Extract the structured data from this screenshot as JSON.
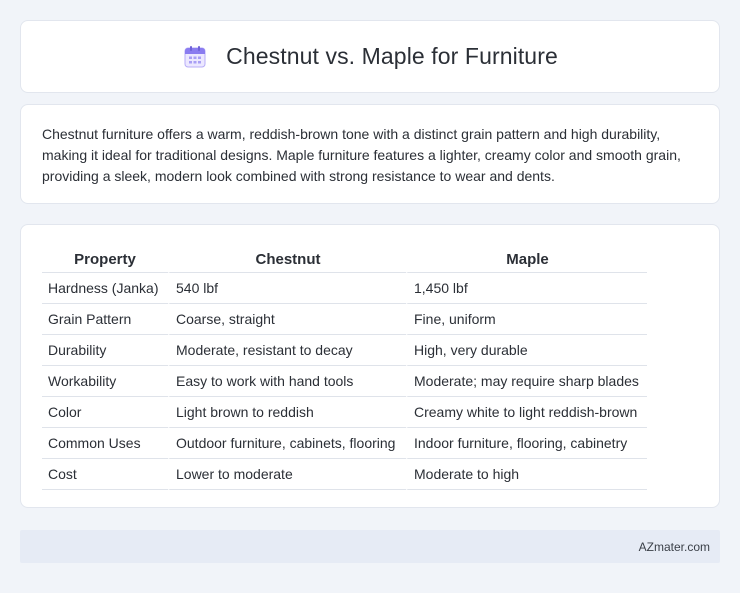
{
  "header": {
    "title": "Chestnut vs. Maple for Furniture",
    "icon": "calendar-icon",
    "icon_color": "#8a7cf0"
  },
  "description": "Chestnut furniture offers a warm, reddish-brown tone with a distinct grain pattern and high durability, making it ideal for traditional designs. Maple furniture features a lighter, creamy color and smooth grain, providing a sleek, modern look combined with strong resistance to wear and dents.",
  "table": {
    "headers": [
      "Property",
      "Chestnut",
      "Maple"
    ],
    "rows": [
      [
        "Hardness (Janka)",
        "540 lbf",
        "1,450 lbf"
      ],
      [
        "Grain Pattern",
        "Coarse, straight",
        "Fine, uniform"
      ],
      [
        "Durability",
        "Moderate, resistant to decay",
        "High, very durable"
      ],
      [
        "Workability",
        "Easy to work with hand tools",
        "Moderate; may require sharp blades"
      ],
      [
        "Color",
        "Light brown to reddish",
        "Creamy white to light reddish-brown"
      ],
      [
        "Common Uses",
        "Outdoor furniture, cabinets, flooring",
        "Indoor furniture, flooring, cabinetry"
      ],
      [
        "Cost",
        "Lower to moderate",
        "Moderate to high"
      ]
    ]
  },
  "footer": {
    "text": "AZmater.com"
  },
  "colors": {
    "background": "#f1f4f9",
    "card": "#ffffff",
    "footer_bg": "#e6ebf5"
  }
}
